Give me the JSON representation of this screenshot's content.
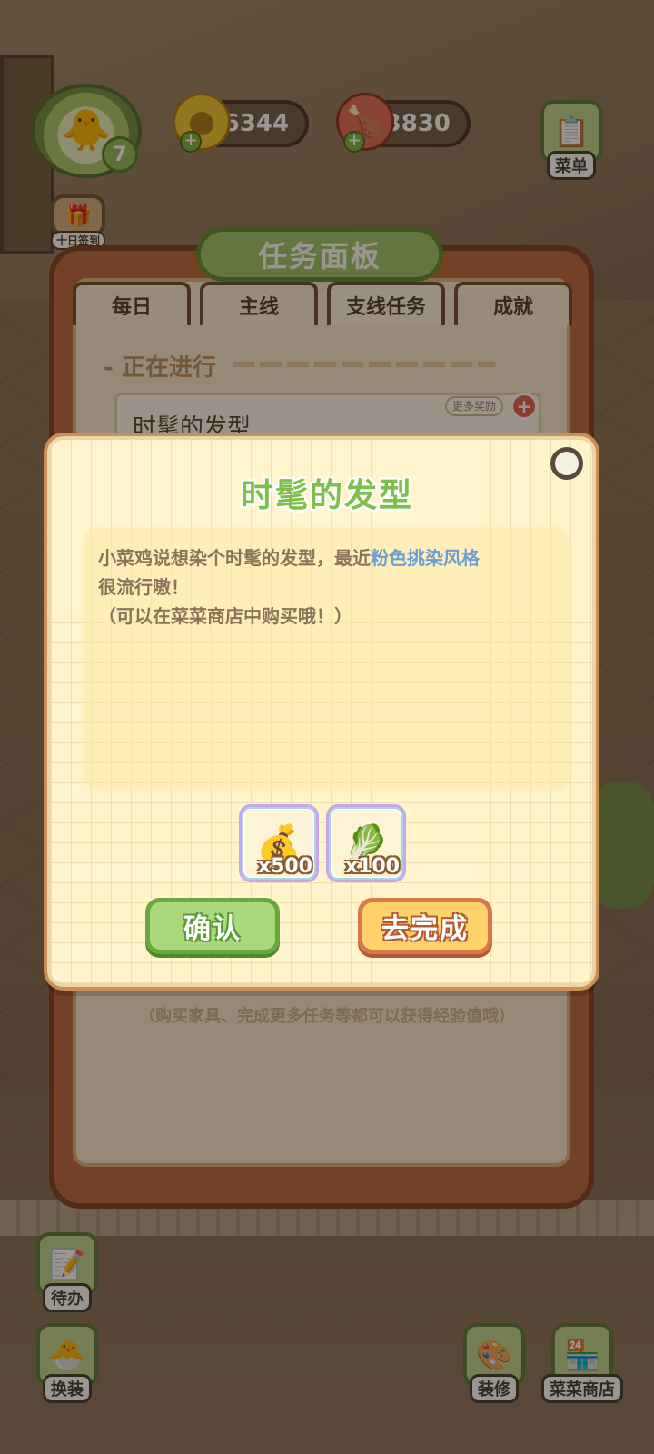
{
  "hud": {
    "level": "7",
    "coins": "6344",
    "food": "3830",
    "menu_label": "菜单",
    "signin_label": "十日签到"
  },
  "panel": {
    "title": "任务面板",
    "tabs": [
      {
        "label": "每日"
      },
      {
        "label": "主线"
      },
      {
        "label": "支线任务"
      },
      {
        "label": "成就"
      }
    ],
    "active_tab": "支线任务",
    "section_label": "- 正在进行",
    "task_name": "时髦的发型",
    "more_rewards": "更多奖励",
    "exp_note": "（购买家具、完成更多任务等都可以获得经验值哦）"
  },
  "dialog": {
    "title": "时髦的发型",
    "desc_part1": "小菜鸡说想染个时髦的发型，最近",
    "desc_highlight": "粉色挑染风格",
    "desc_part2": "很流行嗷！",
    "desc_line3": "（可以在菜菜商店中购买哦！）",
    "rewards": [
      {
        "icon": "gold-coin-pile-icon",
        "qty": "x500"
      },
      {
        "icon": "exp-up-icon",
        "qty": "x100"
      }
    ],
    "confirm_label": "确认",
    "go_label": "去完成"
  },
  "bottom": {
    "todo_label": "待办",
    "dressup_label": "换装",
    "decorate_label": "装修",
    "shop_label": "菜菜商店"
  },
  "colors": {
    "title_green": "#7cc04a",
    "highlight_blue": "#6b9fd1",
    "confirm_green": "#a9d97a",
    "go_yellow": "#ffd26b"
  }
}
